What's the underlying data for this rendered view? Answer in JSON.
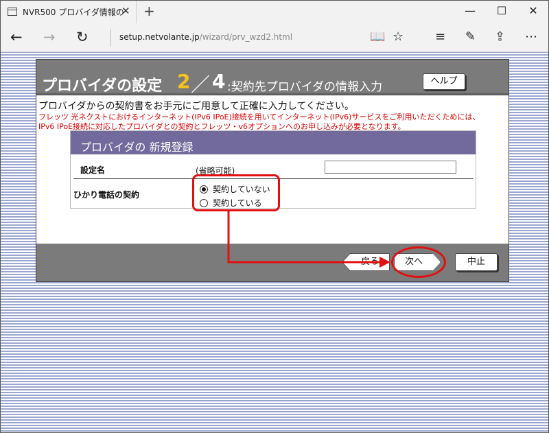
{
  "browser": {
    "tab_title": "NVR500 プロバイダ情報の",
    "tab_close": "✕",
    "new_tab": "+",
    "minimize": "—",
    "maximize": "☐",
    "close": "✕",
    "back": "←",
    "forward": "→",
    "refresh": "↻",
    "url_domain": "setup.netvolante.jp",
    "url_path": "/wizard/prv_wzd2.html",
    "reading_view": "📖",
    "favorite": "☆",
    "hub": "≡",
    "notes": "✎",
    "share": "⇪",
    "more": "⋯"
  },
  "header": {
    "title": "プロバイダの設定",
    "step_current": "2",
    "step_sep": "／",
    "step_total": "4",
    "subtitle": ":契約先プロバイダの情報入力",
    "help_label": "ヘルプ"
  },
  "instructions": {
    "main": "プロバイダからの契約書をお手元にご用意して正確に入力してください。",
    "note_line1": "フレッツ 光ネクストにおけるインターネット(IPv6 IPoE)接続を用いてインターネット(IPv6)サービスをご利用いただくためには、",
    "note_line2": "IPv6 IPoE接続に対応したプロバイダとの契約とフレッツ・v6オプションへのお申し込みが必要となります。"
  },
  "form": {
    "heading": "プロバイダの 新規登録",
    "setting_name_label": "設定名",
    "setting_name_hint": "(省略可能)",
    "setting_name_value": "",
    "hikari_label": "ひかり電話の契約",
    "radio_not_contracted": "契約していない",
    "radio_contracted": "契約している",
    "selected": "契約していない"
  },
  "footer": {
    "back_label": "戻る",
    "next_label": "次へ",
    "cancel_label": "中止"
  },
  "colors": {
    "header_gray": "#7b7b7b",
    "accent_yellow": "#f6c21b",
    "form_header_purple": "#726a9d",
    "note_red": "#d00000",
    "annotation_red": "#e01010"
  }
}
